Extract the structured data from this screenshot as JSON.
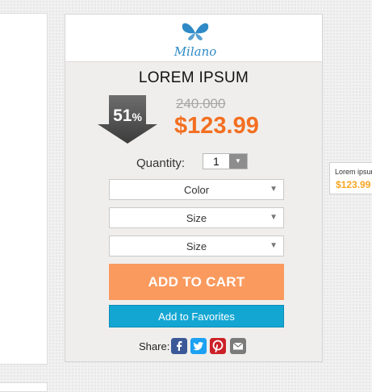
{
  "logo": {
    "text": "Milano"
  },
  "product": {
    "title": "LOREM IPSUM",
    "discount_number": "51",
    "discount_symbol": "%",
    "old_price": "240.000",
    "price": "$123.99"
  },
  "quantity": {
    "label": "Quantity:",
    "value": "1"
  },
  "options": [
    {
      "label": "Color"
    },
    {
      "label": "Size"
    },
    {
      "label": "Size"
    }
  ],
  "buttons": {
    "add_to_cart": "ADD TO CART",
    "add_to_favorites": "Add to Favorites"
  },
  "share": {
    "label": "Share:",
    "icons": [
      "facebook-icon",
      "twitter-icon",
      "pinterest-icon",
      "email-icon"
    ]
  },
  "side_card": {
    "name": "Lorem ipsum",
    "price": "$123.99"
  },
  "colors": {
    "price": "#f36f21",
    "add_to_cart": "#fa9a5e",
    "add_to_favorites": "#14a6d3",
    "facebook": "#3b5998",
    "twitter": "#1da1f2",
    "pinterest": "#cb2027",
    "email": "#7b7b7b"
  }
}
